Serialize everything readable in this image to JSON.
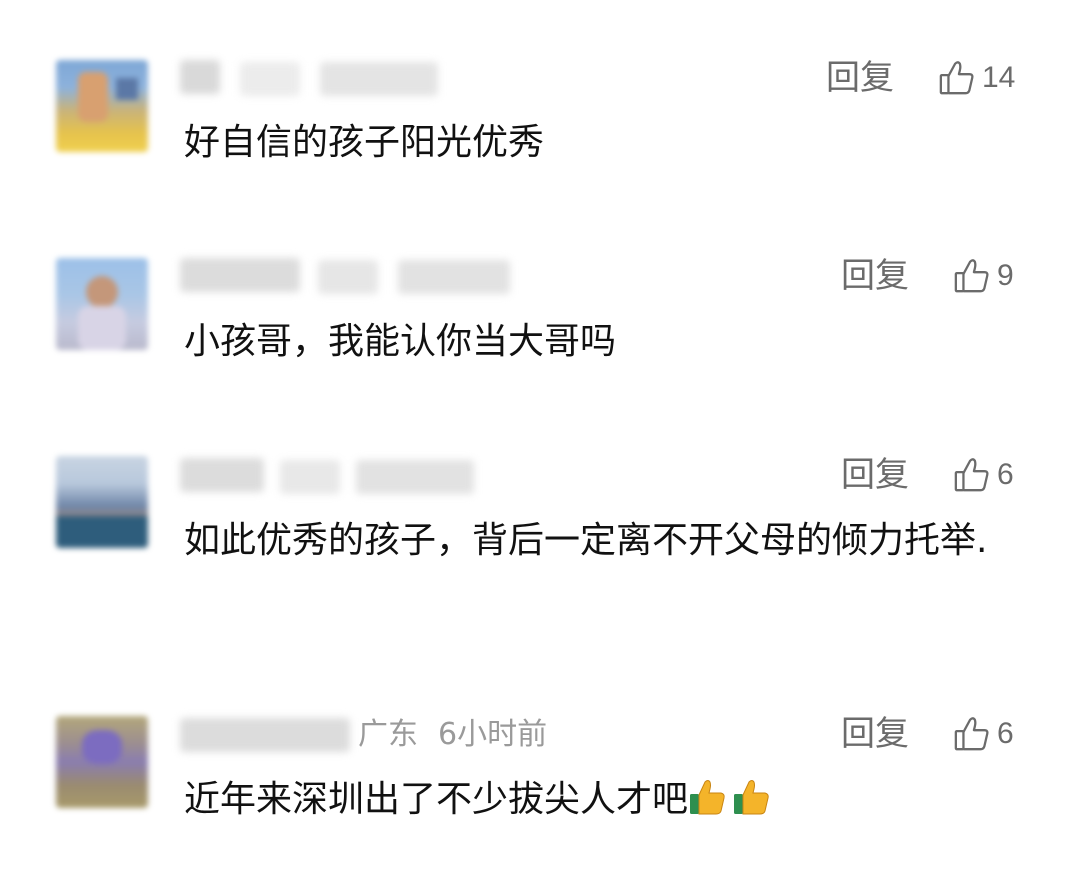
{
  "comments": [
    {
      "reply_label": "回复",
      "like_count": "14",
      "text": "好自信的孩子阳光优秀"
    },
    {
      "reply_label": "回复",
      "like_count": "9",
      "text": "小孩哥，我能认你当大哥吗"
    },
    {
      "reply_label": "回复",
      "like_count": "6",
      "text": "如此优秀的孩子，背后一定离不开父母的倾力托举."
    },
    {
      "reply_label": "回复",
      "like_count": "6",
      "location": "广东",
      "time": "6小时前",
      "text": "近年来深圳出了不少拔尖人才吧"
    }
  ],
  "icons": {
    "like": "thumbs-up-outline-icon",
    "emoji": "thumbs-up-emoji-icon"
  },
  "colors": {
    "reply": "#6b6b6b",
    "meta": "#9a9a9a",
    "text": "#111111"
  }
}
